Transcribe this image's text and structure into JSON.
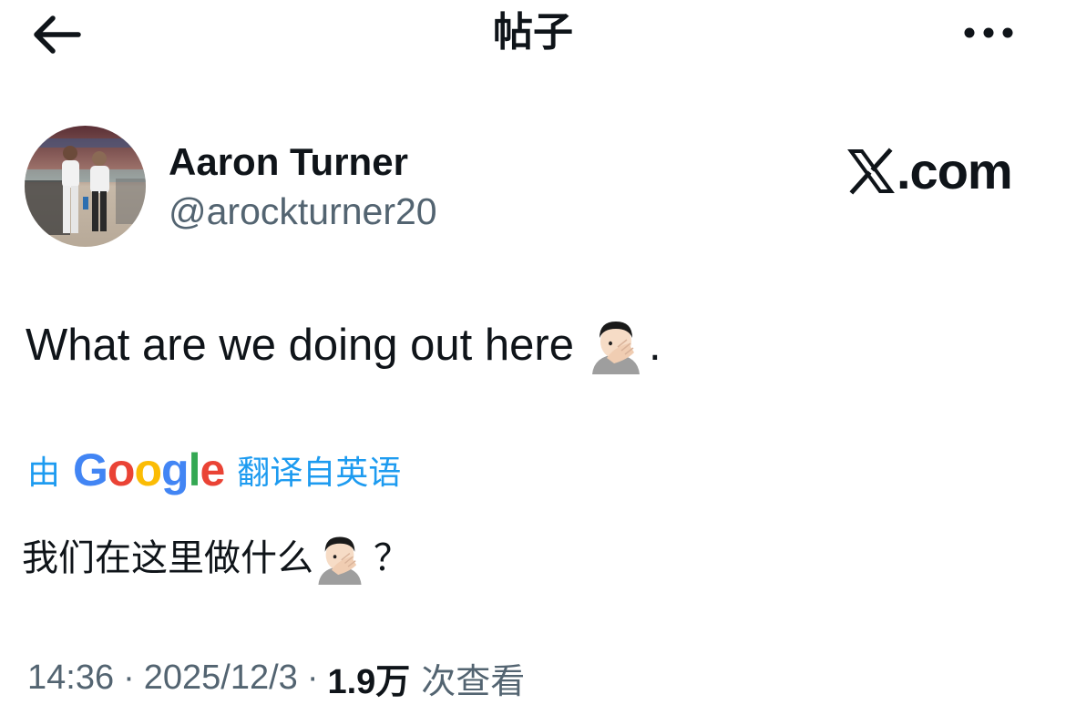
{
  "header": {
    "title": "帖子",
    "back_icon": "arrow-left-icon",
    "more_icon": "more-horizontal-icon"
  },
  "author": {
    "display_name": "Aaron Turner",
    "handle": "@arockturner20",
    "avatar_icon": "profile-photo"
  },
  "brand": {
    "icon": "x-logo-icon",
    "text": ".com"
  },
  "tweet": {
    "text": "What are we doing out here",
    "emoji_icon": "facepalm-emoji",
    "trailing": "."
  },
  "translation": {
    "prefix": "由",
    "provider": "Google",
    "suffix": "翻译自英语",
    "text": "我们在这里做什么",
    "emoji_icon": "facepalm-emoji",
    "trailing": "？"
  },
  "meta": {
    "time": "14:36",
    "date": "2025/12/3",
    "separator": "·",
    "views_count": "1.9万",
    "views_label": "次查看"
  },
  "colors": {
    "text_primary": "#0f1419",
    "text_secondary": "#536471",
    "link_blue": "#1d9bf0"
  }
}
